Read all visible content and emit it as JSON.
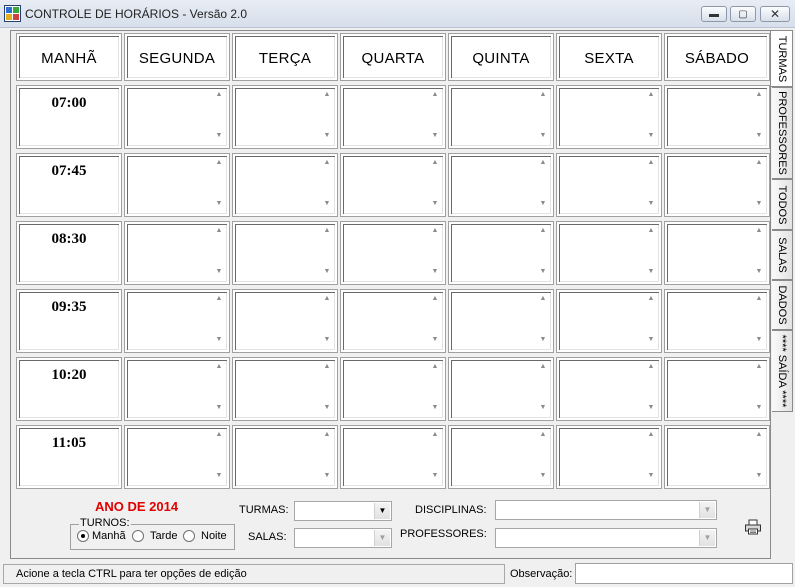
{
  "window": {
    "title": "CONTROLE DE HORÁRIOS - Versão 2.0"
  },
  "header": {
    "labels": [
      "MANHÃ",
      "SEGUNDA",
      "TERÇA",
      "QUARTA",
      "QUINTA",
      "SEXTA",
      "SÁBADO"
    ]
  },
  "times": [
    "07:00",
    "07:45",
    "08:30",
    "09:35",
    "10:20",
    "11:05"
  ],
  "side_tabs": [
    "TURMAS",
    "PROFESSORES",
    "TODOS",
    "SALAS",
    "DADOS",
    "**** SAÍDA ****"
  ],
  "year": "ANO DE 2014",
  "turnos": {
    "legend": "TURNOS:",
    "options": [
      {
        "label": "Manhã",
        "checked": true
      },
      {
        "label": "Tarde",
        "checked": false
      },
      {
        "label": "Noite",
        "checked": false
      }
    ]
  },
  "fields": {
    "turmas": {
      "label": "TURMAS:",
      "value": ""
    },
    "salas": {
      "label": "SALAS:",
      "value": ""
    },
    "disciplinas": {
      "label": "DISCIPLINAS:",
      "value": ""
    },
    "professores": {
      "label": "PROFESSORES:",
      "value": ""
    }
  },
  "status": {
    "hint": "Acione a tecla CTRL para ter opções de edição",
    "observacao_label": "Observação:",
    "observacao_value": ""
  },
  "colors": {
    "year": "#e00000",
    "titlebar": "#dce4ef"
  },
  "icons": {
    "app": "schedule-app-icon",
    "print": "printer-icon"
  }
}
